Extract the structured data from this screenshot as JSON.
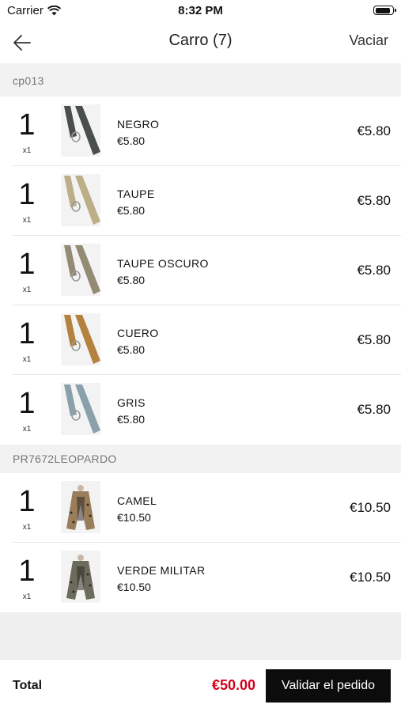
{
  "status_bar": {
    "carrier": "Carrier",
    "time": "8:32 PM",
    "icons": [
      "wifi-icon",
      "battery-icon"
    ]
  },
  "nav": {
    "back_icon": "arrow-left-icon",
    "title": "Carro (7)",
    "action": "Vaciar"
  },
  "sections": [
    {
      "header": "cp013",
      "items": [
        {
          "qty": "1",
          "qty_x": "x1",
          "name": "NEGRO",
          "unit_price": "€5.80",
          "line_total": "€5.80",
          "image": "belt",
          "color": "#4b4f4c"
        },
        {
          "qty": "1",
          "qty_x": "x1",
          "name": "TAUPE",
          "unit_price": "€5.80",
          "line_total": "€5.80",
          "image": "belt",
          "color": "#bcae86"
        },
        {
          "qty": "1",
          "qty_x": "x1",
          "name": "TAUPE OSCURO",
          "unit_price": "€5.80",
          "line_total": "€5.80",
          "image": "belt",
          "color": "#938b73"
        },
        {
          "qty": "1",
          "qty_x": "x1",
          "name": "CUERO",
          "unit_price": "€5.80",
          "line_total": "€5.80",
          "image": "belt",
          "color": "#b3823f"
        },
        {
          "qty": "1",
          "qty_x": "x1",
          "name": "GRIS",
          "unit_price": "€5.80",
          "line_total": "€5.80",
          "image": "belt",
          "color": "#8aa1ab"
        }
      ]
    },
    {
      "header": "PR7672LEOPARDO",
      "items": [
        {
          "qty": "1",
          "qty_x": "x1",
          "name": "CAMEL",
          "unit_price": "€10.50",
          "line_total": "€10.50",
          "image": "garment",
          "color": "#9a7d5a"
        },
        {
          "qty": "1",
          "qty_x": "x1",
          "name": "VERDE MILITAR",
          "unit_price": "€10.50",
          "line_total": "€10.50",
          "image": "garment",
          "color": "#6c6c5c"
        }
      ]
    }
  ],
  "footer": {
    "total_label": "Total",
    "total_amount": "€50.00",
    "checkout_label": "Validar el pedido"
  },
  "colors": {
    "accent_total": "#d0021b",
    "checkout_bg": "#0c0c0c",
    "section_bg": "#f2f2f3"
  }
}
